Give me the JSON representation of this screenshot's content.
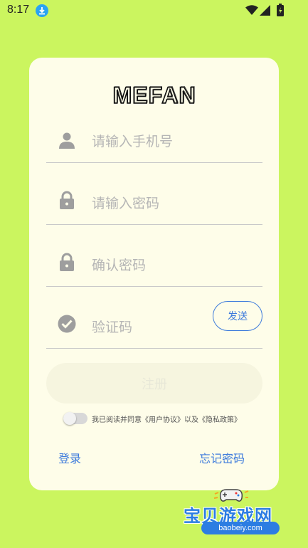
{
  "status_bar": {
    "time": "8:17",
    "icons": [
      "download-icon",
      "wifi-icon",
      "signal-icon",
      "battery-icon"
    ]
  },
  "form": {
    "phone_placeholder": "请输入手机号",
    "password_placeholder": "请输入密码",
    "confirm_placeholder": "确认密码",
    "code_placeholder": "验证码",
    "send_label": "发送",
    "register_label": "注册",
    "agree_text": "我已阅读并同意《用户协议》以及《隐私政策》",
    "agree_toggle_on": false
  },
  "links": {
    "login": "登录",
    "forgot": "忘记密码"
  },
  "logo_text": "MEFAN",
  "watermark": {
    "title": "宝贝游戏网",
    "url": "baobeiy.com"
  },
  "colors": {
    "background": "#cbf55f",
    "card": "#fefde9",
    "accent": "#3d7bdc",
    "icon_gray": "#9e9e9e"
  }
}
